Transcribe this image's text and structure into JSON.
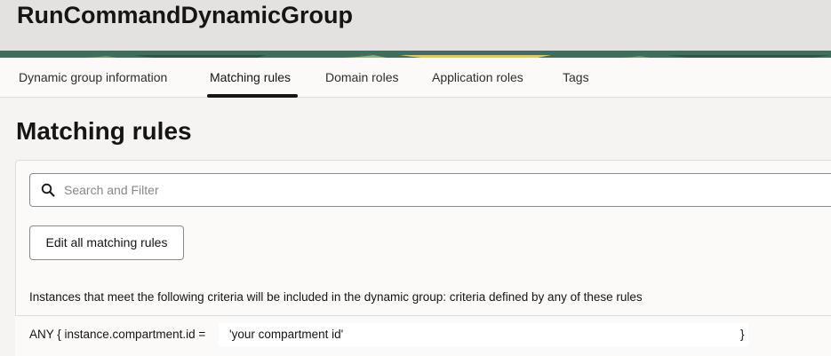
{
  "header": {
    "title": "RunCommandDynamicGroup"
  },
  "tabs": [
    {
      "label": "Dynamic group information",
      "active": false
    },
    {
      "label": "Matching rules",
      "active": true
    },
    {
      "label": "Domain roles",
      "active": false
    },
    {
      "label": "Application roles",
      "active": false
    },
    {
      "label": "Tags",
      "active": false
    }
  ],
  "main": {
    "title": "Matching rules",
    "search": {
      "placeholder": "Search and Filter",
      "value": "",
      "icon": "search-icon"
    },
    "edit_button_label": "Edit all matching rules",
    "criteria_description": "Instances that meet the following criteria will be included in the dynamic group: criteria defined by any of these rules",
    "rule": {
      "prefix": "ANY { instance.compartment.id =",
      "value": "'your compartment id'",
      "suffix": "}"
    }
  },
  "colors": {
    "header_bg": "#e4e2e0",
    "banner": "#3f6e5c",
    "text": "#161513",
    "page_bg": "#f5f4f2"
  }
}
